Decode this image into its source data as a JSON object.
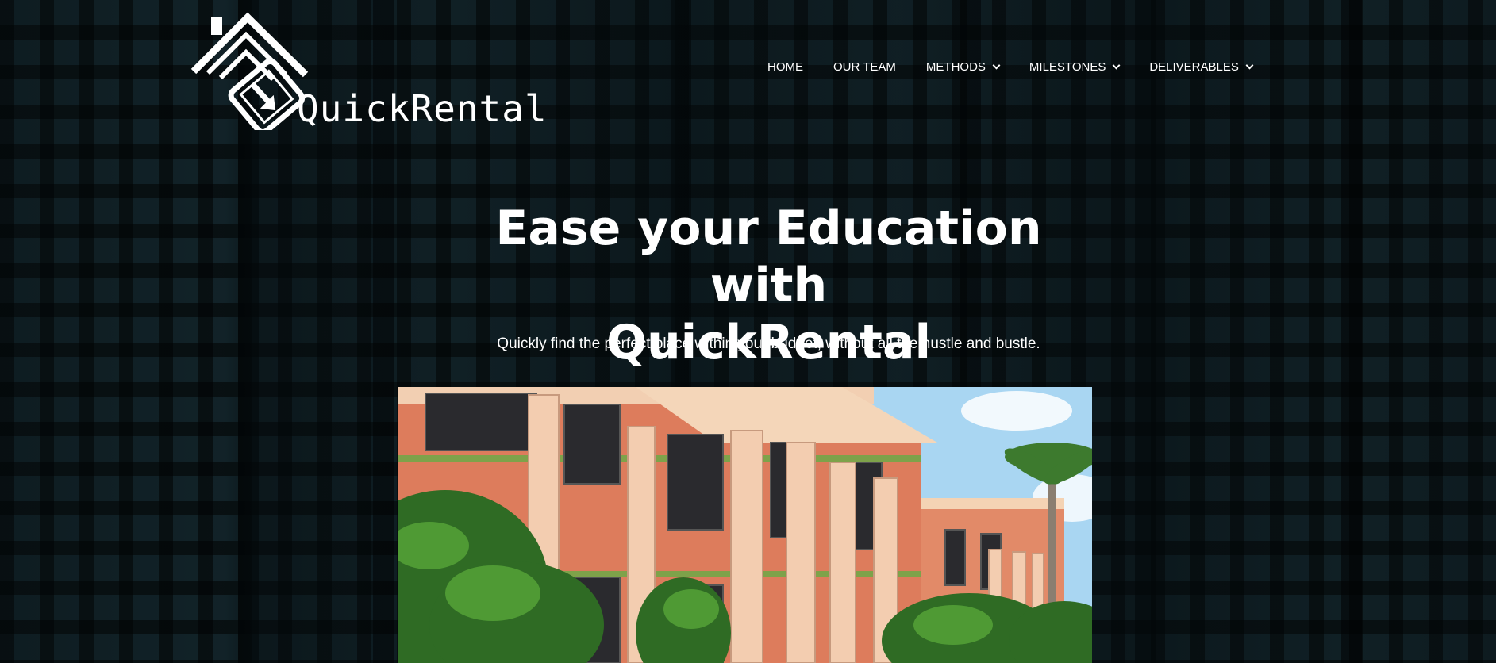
{
  "brand": {
    "name": "QuickRental"
  },
  "nav": {
    "items": [
      {
        "label": "HOME",
        "has_dropdown": false
      },
      {
        "label": "OUR TEAM",
        "has_dropdown": false
      },
      {
        "label": "METHODS",
        "has_dropdown": true
      },
      {
        "label": "MILESTONES",
        "has_dropdown": true
      },
      {
        "label": "DELIVERABLES",
        "has_dropdown": true
      }
    ]
  },
  "hero": {
    "title_line1": "Ease your Education with",
    "title_line2": "QuickRental",
    "subtitle": "Quickly find the perfect place within your budget, without all the hustle and bustle."
  },
  "colors": {
    "background": "#13252b",
    "text": "#ffffff",
    "building": "#e07f5f",
    "columns": "#f3cdb0"
  },
  "icons": {
    "logo": "house-phone-icon",
    "dropdown": "chevron-down-icon"
  }
}
